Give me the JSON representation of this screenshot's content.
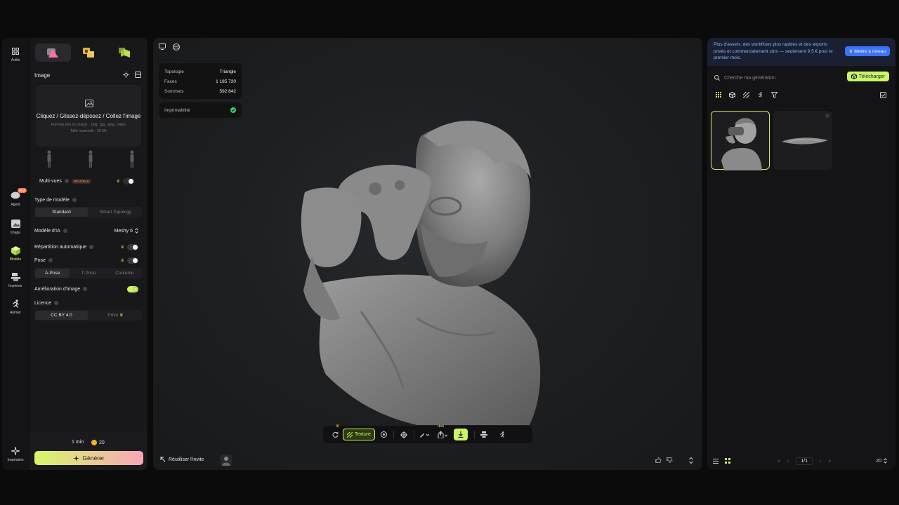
{
  "colors": {
    "accent": "#c9f56a",
    "brand_blue": "#3b74ff",
    "badge_orange": "#ff7a59",
    "ok_green": "#3ad16e"
  },
  "rail": {
    "items": [
      {
        "label": "Actifs",
        "icon": "grid-icon"
      },
      {
        "label": "Agent",
        "icon": "chat-bubble-icon",
        "badge": "NEW"
      },
      {
        "label": "Image",
        "icon": "image-icon"
      },
      {
        "label": "Modèle",
        "icon": "cube-icon"
      },
      {
        "label": "Imprimer",
        "icon": "printer-icon"
      },
      {
        "label": "Animer",
        "icon": "running-figure-icon"
      },
      {
        "label": "Inspiration",
        "icon": "sparkle-icon"
      }
    ]
  },
  "left": {
    "image_title": "Image",
    "dropzone_title": "Cliquez / Glissez-déposez / Collez l'image",
    "dropzone_formats": "Formats pris en charge : .png, .jpg, .jpeg, .webp",
    "dropzone_size": "Taille maximale : 20 Mo",
    "multiview_label": "Multi-vues",
    "multiview_badge": "NOUVEAU",
    "model_type_label": "Type de modèle",
    "model_type_options": [
      "Standard",
      "Smart Topology"
    ],
    "ai_model_label": "Modèle d'IA",
    "ai_model_value": "Meshy 6",
    "auto_split_label": "Répartition automatique",
    "pose_label": "Pose",
    "pose_options": [
      "A-Pose",
      "T-Pose",
      "Coutume"
    ],
    "image_enhance_label": "Amélioration d'image",
    "license_label": "Licence",
    "license_options": [
      "CC BY 4.0",
      "Privé"
    ],
    "time": "1 min",
    "credits": "20",
    "generate_label": "Générer"
  },
  "viewport": {
    "stats": [
      {
        "label": "Topologie",
        "value": "Triangle"
      },
      {
        "label": "Faces",
        "value": "1 185 720"
      },
      {
        "label": "Sommets",
        "value": "592 842"
      }
    ],
    "printable_label": "Imprimabilité",
    "texture_label": "Texture",
    "export_price": "+$20",
    "reuse_prompt_label": "Réutiliser l'invite"
  },
  "right": {
    "promo_text": "Plus d'assets, des workflows plus rapides et des exports privés et commercialement sûrs — seulement 9,5 € pour le premier mois.",
    "upgrade_label": "Mettre à niveau",
    "search_placeholder": "Cherche ma génération",
    "download_label": "Télécharger",
    "page": "1/1",
    "per_page": "20"
  }
}
